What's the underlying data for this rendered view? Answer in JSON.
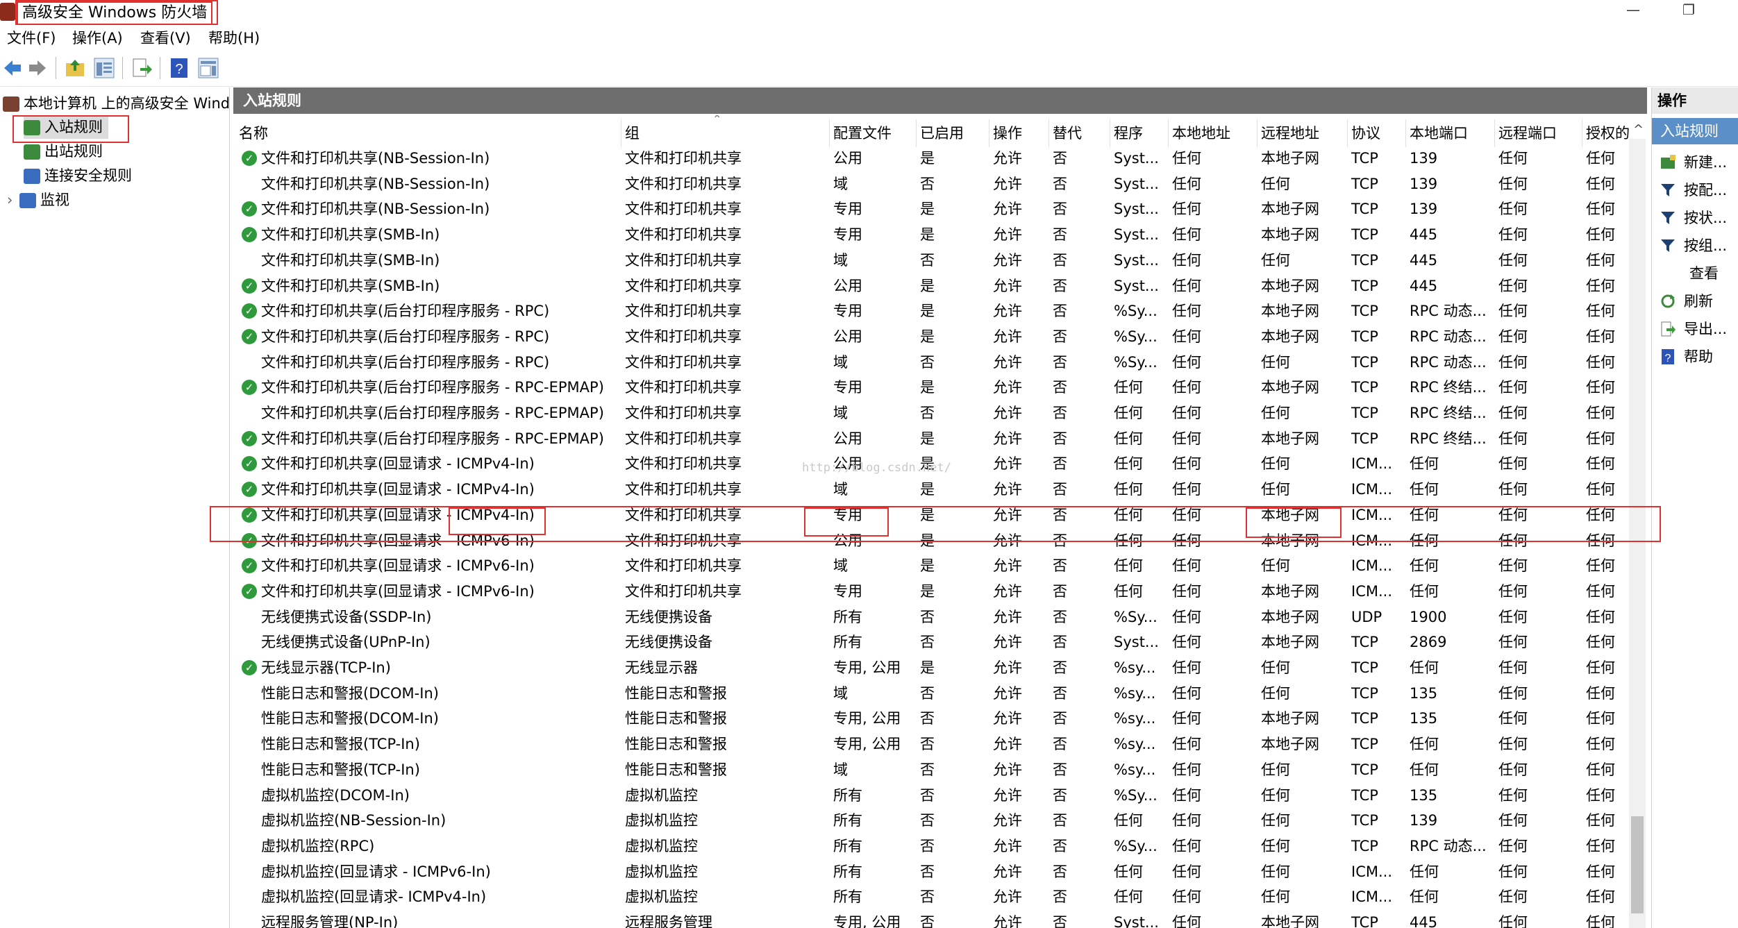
{
  "window": {
    "title": "高级安全 Windows 防火墙",
    "minimize": "—",
    "restore": "❐"
  },
  "menu": [
    "文件(F)",
    "操作(A)",
    "查看(V)",
    "帮助(H)"
  ],
  "tree": {
    "root": "本地计算机 上的高级安全 Windows",
    "items": [
      "入站规则",
      "出站规则",
      "连接安全规则",
      "监视"
    ]
  },
  "panel_title": "入站规则",
  "columns": [
    "名称",
    "组",
    "配置文件",
    "已启用",
    "操作",
    "替代",
    "程序",
    "本地地址",
    "远程地址",
    "协议",
    "本地端口",
    "远程端口",
    "授权的"
  ],
  "rows": [
    {
      "on": true,
      "c": [
        "文件和打印机共享(NB-Session-In)",
        "文件和打印机共享",
        "公用",
        "是",
        "允许",
        "否",
        "Syst...",
        "任何",
        "本地子网",
        "TCP",
        "139",
        "任何",
        "任何"
      ]
    },
    {
      "on": false,
      "c": [
        "文件和打印机共享(NB-Session-In)",
        "文件和打印机共享",
        "域",
        "否",
        "允许",
        "否",
        "Syst...",
        "任何",
        "任何",
        "TCP",
        "139",
        "任何",
        "任何"
      ]
    },
    {
      "on": true,
      "c": [
        "文件和打印机共享(NB-Session-In)",
        "文件和打印机共享",
        "专用",
        "是",
        "允许",
        "否",
        "Syst...",
        "任何",
        "本地子网",
        "TCP",
        "139",
        "任何",
        "任何"
      ]
    },
    {
      "on": true,
      "c": [
        "文件和打印机共享(SMB-In)",
        "文件和打印机共享",
        "专用",
        "是",
        "允许",
        "否",
        "Syst...",
        "任何",
        "本地子网",
        "TCP",
        "445",
        "任何",
        "任何"
      ]
    },
    {
      "on": false,
      "c": [
        "文件和打印机共享(SMB-In)",
        "文件和打印机共享",
        "域",
        "否",
        "允许",
        "否",
        "Syst...",
        "任何",
        "任何",
        "TCP",
        "445",
        "任何",
        "任何"
      ]
    },
    {
      "on": true,
      "c": [
        "文件和打印机共享(SMB-In)",
        "文件和打印机共享",
        "公用",
        "是",
        "允许",
        "否",
        "Syst...",
        "任何",
        "本地子网",
        "TCP",
        "445",
        "任何",
        "任何"
      ]
    },
    {
      "on": true,
      "c": [
        "文件和打印机共享(后台打印程序服务 - RPC)",
        "文件和打印机共享",
        "专用",
        "是",
        "允许",
        "否",
        "%Sy...",
        "任何",
        "本地子网",
        "TCP",
        "RPC 动态...",
        "任何",
        "任何"
      ]
    },
    {
      "on": true,
      "c": [
        "文件和打印机共享(后台打印程序服务 - RPC)",
        "文件和打印机共享",
        "公用",
        "是",
        "允许",
        "否",
        "%Sy...",
        "任何",
        "本地子网",
        "TCP",
        "RPC 动态...",
        "任何",
        "任何"
      ]
    },
    {
      "on": false,
      "c": [
        "文件和打印机共享(后台打印程序服务 - RPC)",
        "文件和打印机共享",
        "域",
        "否",
        "允许",
        "否",
        "%Sy...",
        "任何",
        "任何",
        "TCP",
        "RPC 动态...",
        "任何",
        "任何"
      ]
    },
    {
      "on": true,
      "c": [
        "文件和打印机共享(后台打印程序服务 - RPC-EPMAP)",
        "文件和打印机共享",
        "专用",
        "是",
        "允许",
        "否",
        "任何",
        "任何",
        "本地子网",
        "TCP",
        "RPC 终结...",
        "任何",
        "任何"
      ]
    },
    {
      "on": false,
      "c": [
        "文件和打印机共享(后台打印程序服务 - RPC-EPMAP)",
        "文件和打印机共享",
        "域",
        "否",
        "允许",
        "否",
        "任何",
        "任何",
        "任何",
        "TCP",
        "RPC 终结...",
        "任何",
        "任何"
      ]
    },
    {
      "on": true,
      "c": [
        "文件和打印机共享(后台打印程序服务 - RPC-EPMAP)",
        "文件和打印机共享",
        "公用",
        "是",
        "允许",
        "否",
        "任何",
        "任何",
        "本地子网",
        "TCP",
        "RPC 终结...",
        "任何",
        "任何"
      ]
    },
    {
      "on": true,
      "c": [
        "文件和打印机共享(回显请求 - ICMPv4-In)",
        "文件和打印机共享",
        "公用",
        "是",
        "允许",
        "否",
        "任何",
        "任何",
        "任何",
        "ICM...",
        "任何",
        "任何",
        "任何"
      ]
    },
    {
      "on": true,
      "c": [
        "文件和打印机共享(回显请求 - ICMPv4-In)",
        "文件和打印机共享",
        "域",
        "是",
        "允许",
        "否",
        "任何",
        "任何",
        "任何",
        "ICM...",
        "任何",
        "任何",
        "任何"
      ]
    },
    {
      "on": true,
      "c": [
        "文件和打印机共享(回显请求 - ICMPv4-In)",
        "文件和打印机共享",
        "专用",
        "是",
        "允许",
        "否",
        "任何",
        "任何",
        "本地子网",
        "ICM...",
        "任何",
        "任何",
        "任何"
      ]
    },
    {
      "on": true,
      "c": [
        "文件和打印机共享(回显请求 - ICMPv6-In)",
        "文件和打印机共享",
        "公用",
        "是",
        "允许",
        "否",
        "任何",
        "任何",
        "本地子网",
        "ICM...",
        "任何",
        "任何",
        "任何"
      ]
    },
    {
      "on": true,
      "c": [
        "文件和打印机共享(回显请求 - ICMPv6-In)",
        "文件和打印机共享",
        "域",
        "是",
        "允许",
        "否",
        "任何",
        "任何",
        "任何",
        "ICM...",
        "任何",
        "任何",
        "任何"
      ]
    },
    {
      "on": true,
      "c": [
        "文件和打印机共享(回显请求 - ICMPv6-In)",
        "文件和打印机共享",
        "专用",
        "是",
        "允许",
        "否",
        "任何",
        "任何",
        "本地子网",
        "ICM...",
        "任何",
        "任何",
        "任何"
      ]
    },
    {
      "on": false,
      "c": [
        "无线便携式设备(SSDP-In)",
        "无线便携设备",
        "所有",
        "否",
        "允许",
        "否",
        "%Sy...",
        "任何",
        "本地子网",
        "UDP",
        "1900",
        "任何",
        "任何"
      ]
    },
    {
      "on": false,
      "c": [
        "无线便携式设备(UPnP-In)",
        "无线便携设备",
        "所有",
        "否",
        "允许",
        "否",
        "Syst...",
        "任何",
        "本地子网",
        "TCP",
        "2869",
        "任何",
        "任何"
      ]
    },
    {
      "on": true,
      "c": [
        "无线显示器(TCP-In)",
        "无线显示器",
        "专用, 公用",
        "是",
        "允许",
        "否",
        "%sy...",
        "任何",
        "任何",
        "TCP",
        "任何",
        "任何",
        "任何"
      ]
    },
    {
      "on": false,
      "c": [
        "性能日志和警报(DCOM-In)",
        "性能日志和警报",
        "域",
        "否",
        "允许",
        "否",
        "%sy...",
        "任何",
        "任何",
        "TCP",
        "135",
        "任何",
        "任何"
      ]
    },
    {
      "on": false,
      "c": [
        "性能日志和警报(DCOM-In)",
        "性能日志和警报",
        "专用, 公用",
        "否",
        "允许",
        "否",
        "%sy...",
        "任何",
        "本地子网",
        "TCP",
        "135",
        "任何",
        "任何"
      ]
    },
    {
      "on": false,
      "c": [
        "性能日志和警报(TCP-In)",
        "性能日志和警报",
        "专用, 公用",
        "否",
        "允许",
        "否",
        "%sy...",
        "任何",
        "本地子网",
        "TCP",
        "任何",
        "任何",
        "任何"
      ]
    },
    {
      "on": false,
      "c": [
        "性能日志和警报(TCP-In)",
        "性能日志和警报",
        "域",
        "否",
        "允许",
        "否",
        "%sy...",
        "任何",
        "任何",
        "TCP",
        "任何",
        "任何",
        "任何"
      ]
    },
    {
      "on": false,
      "c": [
        "虚拟机监控(DCOM-In)",
        "虚拟机监控",
        "所有",
        "否",
        "允许",
        "否",
        "%Sy...",
        "任何",
        "任何",
        "TCP",
        "135",
        "任何",
        "任何"
      ]
    },
    {
      "on": false,
      "c": [
        "虚拟机监控(NB-Session-In)",
        "虚拟机监控",
        "所有",
        "否",
        "允许",
        "否",
        "任何",
        "任何",
        "任何",
        "TCP",
        "139",
        "任何",
        "任何"
      ]
    },
    {
      "on": false,
      "c": [
        "虚拟机监控(RPC)",
        "虚拟机监控",
        "所有",
        "否",
        "允许",
        "否",
        "%Sy...",
        "任何",
        "任何",
        "TCP",
        "RPC 动态...",
        "任何",
        "任何"
      ]
    },
    {
      "on": false,
      "c": [
        "虚拟机监控(回显请求 - ICMPv6-In)",
        "虚拟机监控",
        "所有",
        "否",
        "允许",
        "否",
        "任何",
        "任何",
        "任何",
        "ICM...",
        "任何",
        "任何",
        "任何"
      ]
    },
    {
      "on": false,
      "c": [
        "虚拟机监控(回显请求- ICMPv4-In)",
        "虚拟机监控",
        "所有",
        "否",
        "允许",
        "否",
        "任何",
        "任何",
        "任何",
        "ICM...",
        "任何",
        "任何",
        "任何"
      ]
    },
    {
      "on": false,
      "c": [
        "远程服务管理(NP-In)",
        "远程服务管理",
        "专用, 公用",
        "否",
        "允许",
        "否",
        "Syst...",
        "任何",
        "本地子网",
        "TCP",
        "445",
        "任何",
        "任何"
      ]
    }
  ],
  "actions": {
    "title": "操作",
    "section": "入站规则",
    "items": [
      {
        "label": "新建...",
        "icon": "new-rule-icon"
      },
      {
        "label": "按配...",
        "icon": "filter-icon"
      },
      {
        "label": "按状...",
        "icon": "filter-icon"
      },
      {
        "label": "按组...",
        "icon": "filter-icon"
      },
      {
        "label": "查看",
        "icon": "none"
      },
      {
        "label": "刷新",
        "icon": "refresh-icon"
      },
      {
        "label": "导出...",
        "icon": "export-icon"
      },
      {
        "label": "帮助",
        "icon": "help-icon"
      }
    ]
  },
  "watermark": "http://blog.csdn.net/"
}
